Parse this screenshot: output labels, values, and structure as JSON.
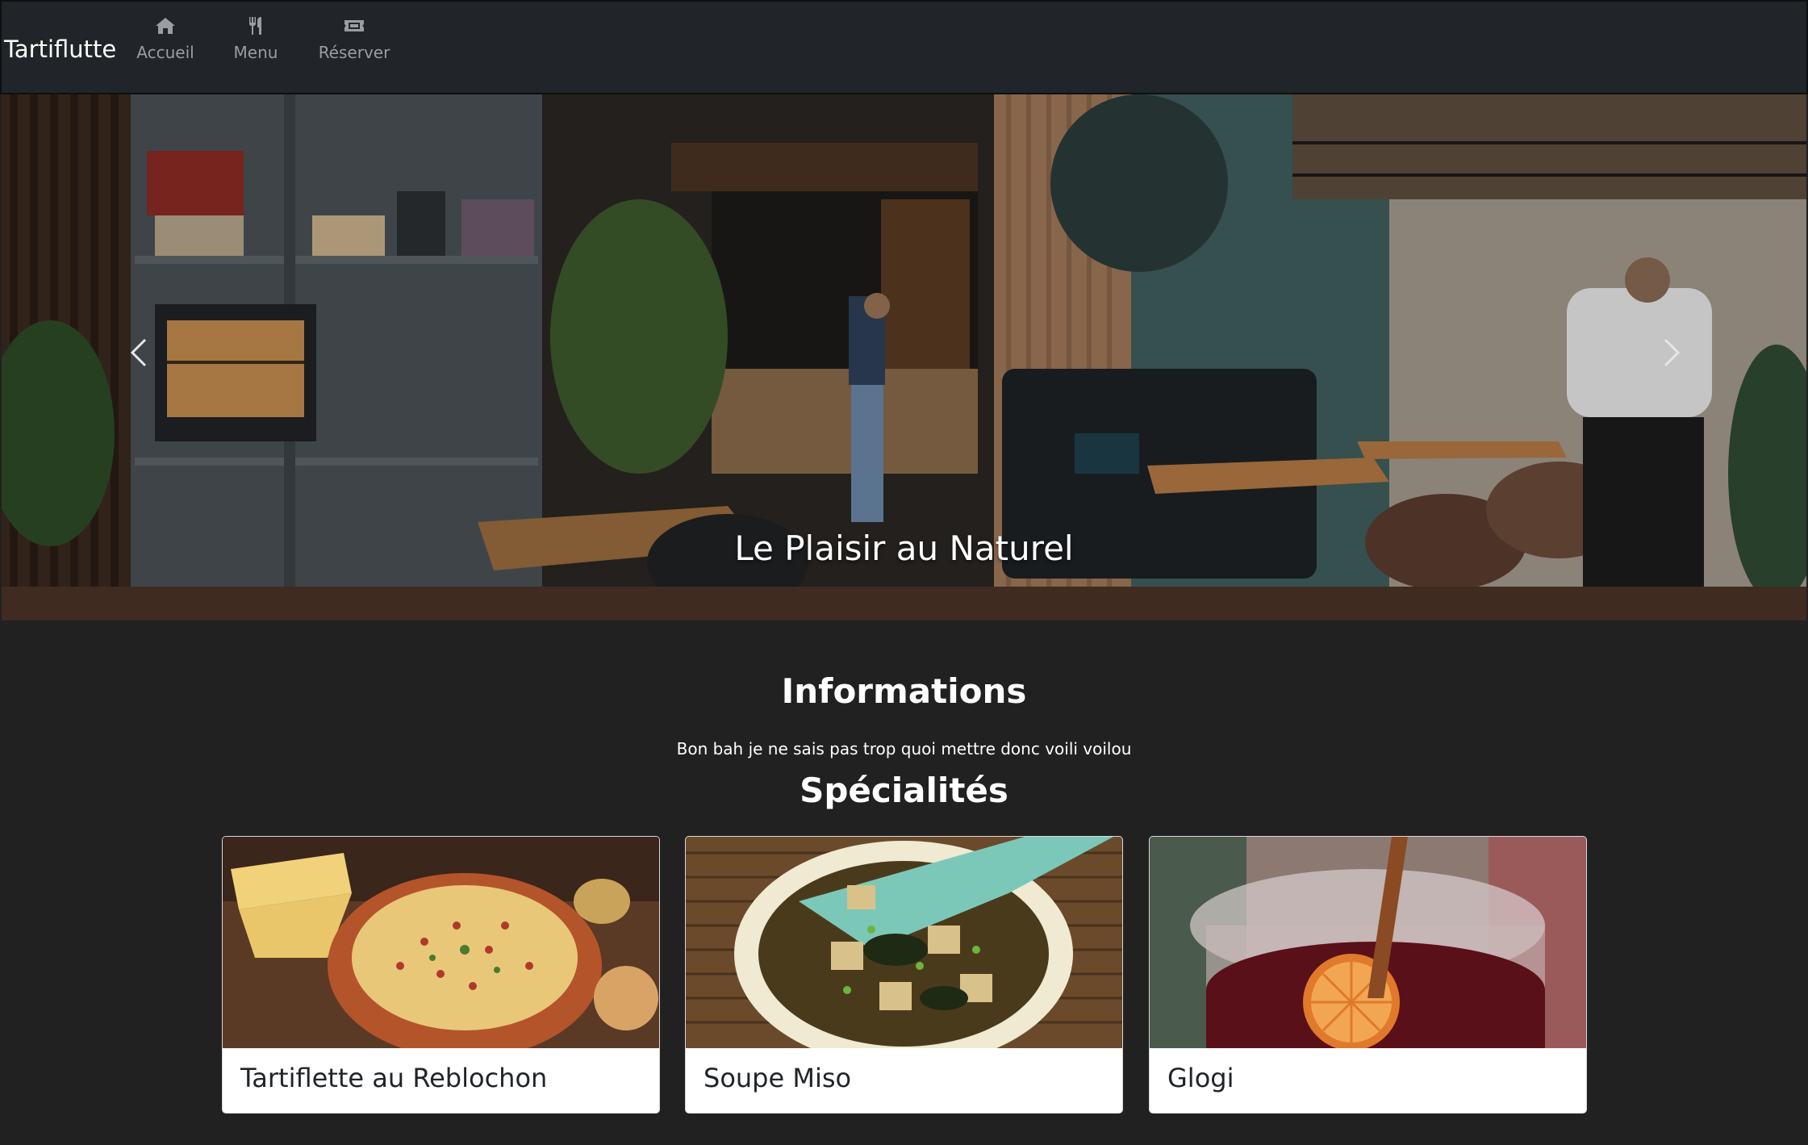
{
  "navbar": {
    "brand": "Tartiflutte",
    "items": [
      {
        "label": "Accueil",
        "icon": "home-icon"
      },
      {
        "label": "Menu",
        "icon": "utensils-icon"
      },
      {
        "label": "Réserver",
        "icon": "ticket-icon"
      }
    ]
  },
  "hero": {
    "caption": "Le Plaisir au Naturel",
    "image": "restaurant-interior-photo"
  },
  "info": {
    "title": "Informations",
    "text": "Bon bah je ne sais pas trop quoi mettre donc voili voilou"
  },
  "specialties": {
    "title": "Spécialités",
    "cards": [
      {
        "title": "Tartiflette au Reblochon",
        "image": "tartiflette-photo"
      },
      {
        "title": "Soupe Miso",
        "image": "miso-soup-photo"
      },
      {
        "title": "Glogi",
        "image": "mulled-wine-photo"
      }
    ]
  },
  "colors": {
    "page_bg": "#212121",
    "navbar_bg": "#212529",
    "nav_text": "#9a9ea3",
    "card_bg": "#ffffff",
    "card_text": "#212529"
  }
}
